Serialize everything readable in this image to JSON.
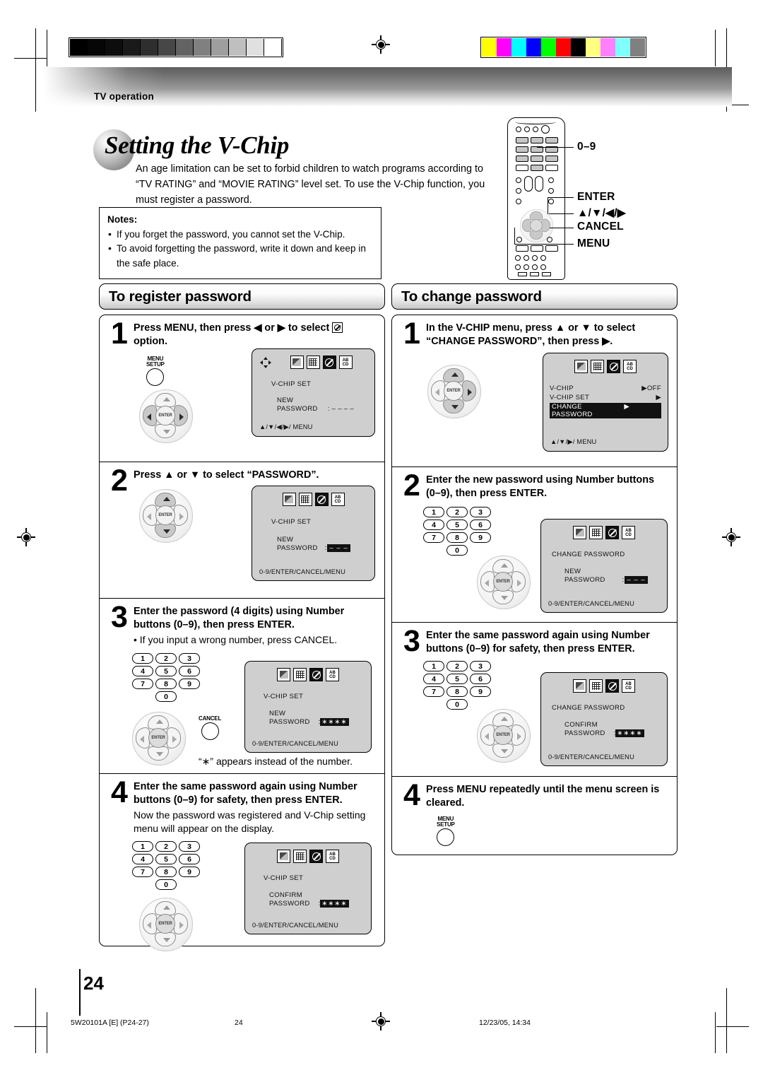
{
  "header": {
    "breadcrumb": "TV operation"
  },
  "title": "Setting the V-Chip",
  "intro": "An age limitation can be set to forbid children to watch programs according to “TV RATING” and “MOVIE RATING” level set. To use the V-Chip function, you must register a password.",
  "notes": {
    "heading": "Notes:",
    "items": [
      "If you forget the password, you cannot set the V-Chip.",
      "To avoid forgetting the password, write it down and keep in the safe place."
    ]
  },
  "remote": {
    "labels": [
      "0–9",
      "ENTER",
      "▲/▼/◀/▶",
      "CANCEL",
      "MENU"
    ]
  },
  "sections": [
    {
      "heading": "To register password",
      "steps": [
        {
          "num": "1",
          "text_before": "Press MENU, then press ◀ or ▶ to select ",
          "text_after": " option.",
          "button_label_1": "MENU",
          "button_label_2": "SETUP",
          "osd": {
            "title": "V-CHIP  SET",
            "label_line1": "NEW",
            "label_line2": "PASSWORD",
            "value": ": – – – –",
            "footer": "▲/▼/◀/▶/ MENU",
            "icons": [
              "picture-icon",
              "grid-icon",
              "vchip-icon",
              "abcd-icon"
            ],
            "icon_abcd_top": "AB",
            "icon_abcd_bottom": "CD"
          }
        },
        {
          "num": "2",
          "text": "Press ▲ or ▼ to select “PASSWORD”.",
          "osd": {
            "title": "V-CHIP  SET",
            "label_line1": "NEW",
            "label_line2": "PASSWORD",
            "value": "– – –",
            "footer": "0-9/ENTER/CANCEL/MENU"
          }
        },
        {
          "num": "3",
          "text": "Enter the password (4 digits) using Number buttons (0–9), then press ENTER.",
          "subtext": "• If you input a wrong number, press CANCEL.",
          "caption": "“∗” appears instead of the number.",
          "cancel_label": "CANCEL",
          "keys": [
            "1",
            "2",
            "3",
            "4",
            "5",
            "6",
            "7",
            "8",
            "9",
            "0"
          ],
          "osd": {
            "title": "V-CHIP  SET",
            "label_line1": "NEW",
            "label_line2": "PASSWORD",
            "value": "∗∗∗∗",
            "footer": "0-9/ENTER/CANCEL/MENU"
          }
        },
        {
          "num": "4",
          "text": "Enter the same password again using Number buttons (0–9) for safety, then press ENTER.",
          "subtext": "Now the password was registered and V-Chip setting menu will appear on the display.",
          "keys": [
            "1",
            "2",
            "3",
            "4",
            "5",
            "6",
            "7",
            "8",
            "9",
            "0"
          ],
          "osd": {
            "title": "V-CHIP  SET",
            "label_line1": "CONFIRM",
            "label_line2": "PASSWORD",
            "value": "∗∗∗∗",
            "footer": "0-9/ENTER/CANCEL/MENU"
          }
        }
      ]
    },
    {
      "heading": "To change password",
      "steps": [
        {
          "num": "1",
          "text": "In the V-CHIP menu, press ▲ or ▼ to select “CHANGE PASSWORD”, then press ▶.",
          "osd": {
            "rows": [
              {
                "label": "V-CHIP",
                "value": "▶OFF",
                "highlight": false
              },
              {
                "label": "V-CHIP SET",
                "value": "▶",
                "highlight": false
              },
              {
                "label": "CHANGE PASSWORD",
                "value": "▶",
                "highlight": true
              }
            ],
            "footer": "▲/▼/▶/ MENU"
          }
        },
        {
          "num": "2",
          "text": "Enter the new password using Number buttons (0–9), then press ENTER.",
          "keys": [
            "1",
            "2",
            "3",
            "4",
            "5",
            "6",
            "7",
            "8",
            "9",
            "0"
          ],
          "osd": {
            "title": "CHANGE  PASSWORD",
            "label_line1": "NEW",
            "label_line2": "PASSWORD",
            "value": "– – –",
            "footer": "0-9/ENTER/CANCEL/MENU"
          }
        },
        {
          "num": "3",
          "text": "Enter the same password again using Number buttons (0–9) for safety, then press ENTER.",
          "keys": [
            "1",
            "2",
            "3",
            "4",
            "5",
            "6",
            "7",
            "8",
            "9",
            "0"
          ],
          "osd": {
            "title": "CHANGE  PASSWORD",
            "label_line1": "CONFIRM",
            "label_line2": "PASSWORD",
            "value": "∗∗∗∗",
            "footer": "0-9/ENTER/CANCEL/MENU"
          }
        },
        {
          "num": "4",
          "text": "Press MENU repeatedly until the menu screen is cleared.",
          "button_label_1": "MENU",
          "button_label_2": "SETUP"
        }
      ]
    }
  ],
  "footer": {
    "page": "24",
    "doc_code": "5W20101A [E] (P24-27)",
    "page_mark": "24",
    "timestamp": "12/23/05, 14:34"
  },
  "calibration": {
    "gray_steps": [
      "#000000",
      "#060606",
      "#0d0d0d",
      "#1a1a1a",
      "#2e2e2e",
      "#474747",
      "#636363",
      "#808080",
      "#9e9e9e",
      "#bfbfbf",
      "#e0e0e0",
      "#ffffff"
    ],
    "colors": [
      "#ffff00",
      "#ff00ff",
      "#00ffff",
      "#0000ff",
      "#00ff00",
      "#ff0000",
      "#000000",
      "#ffff80",
      "#ff80ff",
      "#80ffff",
      "#808080"
    ]
  }
}
